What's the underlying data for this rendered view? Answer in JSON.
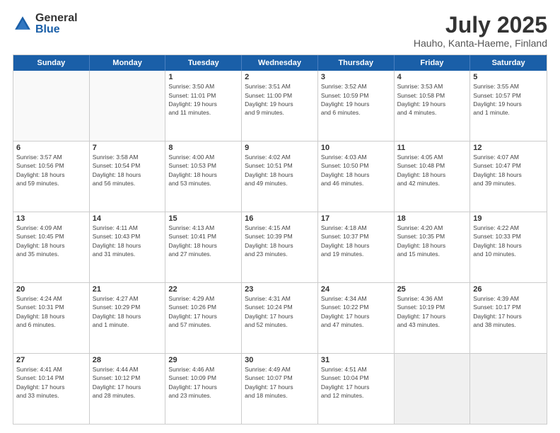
{
  "logo": {
    "general": "General",
    "blue": "Blue"
  },
  "title": "July 2025",
  "subtitle": "Hauho, Kanta-Haeme, Finland",
  "header_days": [
    "Sunday",
    "Monday",
    "Tuesday",
    "Wednesday",
    "Thursday",
    "Friday",
    "Saturday"
  ],
  "weeks": [
    [
      {
        "day": "",
        "info": ""
      },
      {
        "day": "",
        "info": ""
      },
      {
        "day": "1",
        "info": "Sunrise: 3:50 AM\nSunset: 11:01 PM\nDaylight: 19 hours\nand 11 minutes."
      },
      {
        "day": "2",
        "info": "Sunrise: 3:51 AM\nSunset: 11:00 PM\nDaylight: 19 hours\nand 9 minutes."
      },
      {
        "day": "3",
        "info": "Sunrise: 3:52 AM\nSunset: 10:59 PM\nDaylight: 19 hours\nand 6 minutes."
      },
      {
        "day": "4",
        "info": "Sunrise: 3:53 AM\nSunset: 10:58 PM\nDaylight: 19 hours\nand 4 minutes."
      },
      {
        "day": "5",
        "info": "Sunrise: 3:55 AM\nSunset: 10:57 PM\nDaylight: 19 hours\nand 1 minute."
      }
    ],
    [
      {
        "day": "6",
        "info": "Sunrise: 3:57 AM\nSunset: 10:56 PM\nDaylight: 18 hours\nand 59 minutes."
      },
      {
        "day": "7",
        "info": "Sunrise: 3:58 AM\nSunset: 10:54 PM\nDaylight: 18 hours\nand 56 minutes."
      },
      {
        "day": "8",
        "info": "Sunrise: 4:00 AM\nSunset: 10:53 PM\nDaylight: 18 hours\nand 53 minutes."
      },
      {
        "day": "9",
        "info": "Sunrise: 4:02 AM\nSunset: 10:51 PM\nDaylight: 18 hours\nand 49 minutes."
      },
      {
        "day": "10",
        "info": "Sunrise: 4:03 AM\nSunset: 10:50 PM\nDaylight: 18 hours\nand 46 minutes."
      },
      {
        "day": "11",
        "info": "Sunrise: 4:05 AM\nSunset: 10:48 PM\nDaylight: 18 hours\nand 42 minutes."
      },
      {
        "day": "12",
        "info": "Sunrise: 4:07 AM\nSunset: 10:47 PM\nDaylight: 18 hours\nand 39 minutes."
      }
    ],
    [
      {
        "day": "13",
        "info": "Sunrise: 4:09 AM\nSunset: 10:45 PM\nDaylight: 18 hours\nand 35 minutes."
      },
      {
        "day": "14",
        "info": "Sunrise: 4:11 AM\nSunset: 10:43 PM\nDaylight: 18 hours\nand 31 minutes."
      },
      {
        "day": "15",
        "info": "Sunrise: 4:13 AM\nSunset: 10:41 PM\nDaylight: 18 hours\nand 27 minutes."
      },
      {
        "day": "16",
        "info": "Sunrise: 4:15 AM\nSunset: 10:39 PM\nDaylight: 18 hours\nand 23 minutes."
      },
      {
        "day": "17",
        "info": "Sunrise: 4:18 AM\nSunset: 10:37 PM\nDaylight: 18 hours\nand 19 minutes."
      },
      {
        "day": "18",
        "info": "Sunrise: 4:20 AM\nSunset: 10:35 PM\nDaylight: 18 hours\nand 15 minutes."
      },
      {
        "day": "19",
        "info": "Sunrise: 4:22 AM\nSunset: 10:33 PM\nDaylight: 18 hours\nand 10 minutes."
      }
    ],
    [
      {
        "day": "20",
        "info": "Sunrise: 4:24 AM\nSunset: 10:31 PM\nDaylight: 18 hours\nand 6 minutes."
      },
      {
        "day": "21",
        "info": "Sunrise: 4:27 AM\nSunset: 10:29 PM\nDaylight: 18 hours\nand 1 minute."
      },
      {
        "day": "22",
        "info": "Sunrise: 4:29 AM\nSunset: 10:26 PM\nDaylight: 17 hours\nand 57 minutes."
      },
      {
        "day": "23",
        "info": "Sunrise: 4:31 AM\nSunset: 10:24 PM\nDaylight: 17 hours\nand 52 minutes."
      },
      {
        "day": "24",
        "info": "Sunrise: 4:34 AM\nSunset: 10:22 PM\nDaylight: 17 hours\nand 47 minutes."
      },
      {
        "day": "25",
        "info": "Sunrise: 4:36 AM\nSunset: 10:19 PM\nDaylight: 17 hours\nand 43 minutes."
      },
      {
        "day": "26",
        "info": "Sunrise: 4:39 AM\nSunset: 10:17 PM\nDaylight: 17 hours\nand 38 minutes."
      }
    ],
    [
      {
        "day": "27",
        "info": "Sunrise: 4:41 AM\nSunset: 10:14 PM\nDaylight: 17 hours\nand 33 minutes."
      },
      {
        "day": "28",
        "info": "Sunrise: 4:44 AM\nSunset: 10:12 PM\nDaylight: 17 hours\nand 28 minutes."
      },
      {
        "day": "29",
        "info": "Sunrise: 4:46 AM\nSunset: 10:09 PM\nDaylight: 17 hours\nand 23 minutes."
      },
      {
        "day": "30",
        "info": "Sunrise: 4:49 AM\nSunset: 10:07 PM\nDaylight: 17 hours\nand 18 minutes."
      },
      {
        "day": "31",
        "info": "Sunrise: 4:51 AM\nSunset: 10:04 PM\nDaylight: 17 hours\nand 12 minutes."
      },
      {
        "day": "",
        "info": ""
      },
      {
        "day": "",
        "info": ""
      }
    ]
  ]
}
